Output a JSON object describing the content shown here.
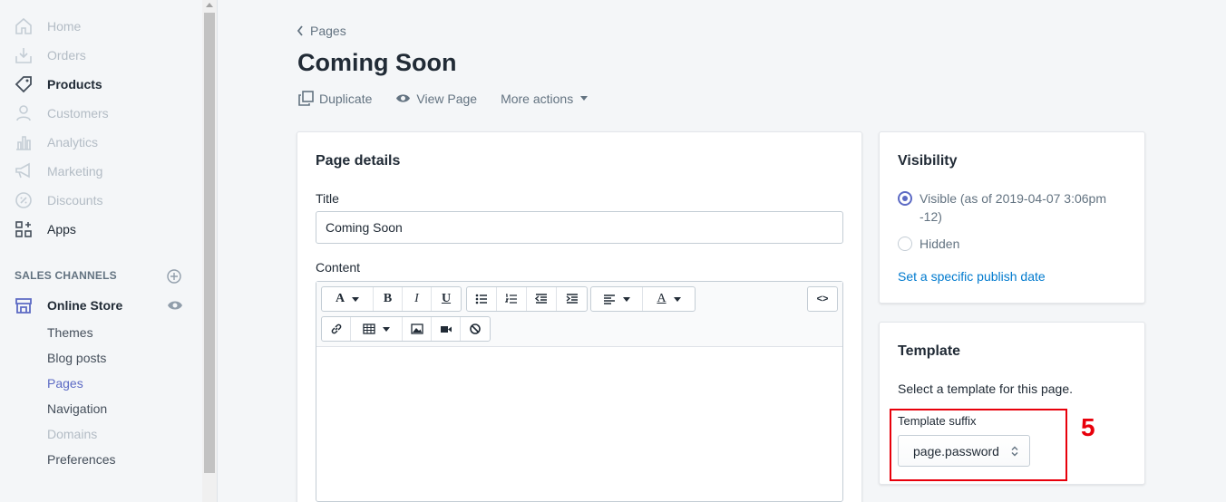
{
  "sidebar": {
    "items": [
      {
        "label": "Home",
        "icon": "home-icon"
      },
      {
        "label": "Orders",
        "icon": "orders-icon"
      },
      {
        "label": "Products",
        "icon": "tag-icon"
      },
      {
        "label": "Customers",
        "icon": "person-icon"
      },
      {
        "label": "Analytics",
        "icon": "bar-chart-icon"
      },
      {
        "label": "Marketing",
        "icon": "megaphone-icon"
      },
      {
        "label": "Discounts",
        "icon": "discount-icon"
      },
      {
        "label": "Apps",
        "icon": "apps-icon"
      }
    ],
    "sales_channels_heading": "SALES CHANNELS",
    "online_store": "Online Store",
    "sub_items": [
      "Themes",
      "Blog posts",
      "Pages",
      "Navigation",
      "Domains",
      "Preferences"
    ]
  },
  "header": {
    "breadcrumb": "Pages",
    "title": "Coming Soon",
    "actions": {
      "duplicate": "Duplicate",
      "view_page": "View Page",
      "more_actions": "More actions"
    }
  },
  "page_details": {
    "heading": "Page details",
    "title_label": "Title",
    "title_value": "Coming Soon",
    "content_label": "Content",
    "toolbar": {
      "font_button": "A",
      "bold": "B",
      "italic": "I",
      "underline": "U",
      "text_color": "A",
      "html_toggle": "<>"
    }
  },
  "visibility": {
    "heading": "Visibility",
    "visible_label": "Visible (as of 2019-04-07 3:06pm -12)",
    "hidden_label": "Hidden",
    "publish_link": "Set a specific publish date",
    "selected": "visible"
  },
  "template": {
    "heading": "Template",
    "description": "Select a template for this page.",
    "suffix_label": "Template suffix",
    "suffix_value": "page.password"
  },
  "annotation": {
    "step": "5",
    "color": "#e8000b"
  },
  "colors": {
    "accent": "#5c6ac4",
    "link": "#007ace"
  }
}
